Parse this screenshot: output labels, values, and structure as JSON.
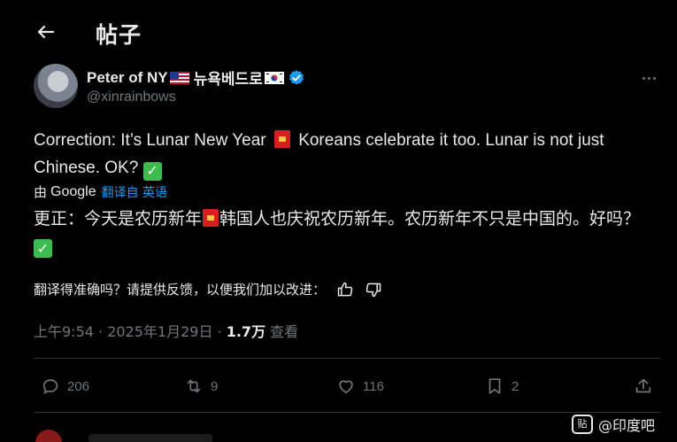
{
  "header": {
    "title": "帖子"
  },
  "author": {
    "name": "Peter of NY",
    "name_suffix": "뉴욕베드로",
    "handle": "@xinrainbows"
  },
  "tweet": {
    "text_part1": "Correction: It’s Lunar New Year",
    "text_part2": "Koreans celebrate it too. Lunar is not just Chinese. OK?"
  },
  "translation": {
    "by_label": "由",
    "provider": "Google",
    "link_label": "翻译自 英语",
    "text_part1": "更正：今天是农历新年",
    "text_part2": "韩国人也庆祝农历新年。农历新年不只是中国的。好吗？"
  },
  "feedback": {
    "prompt": "翻译得准确吗？请提供反馈，以便我们加以改进："
  },
  "meta": {
    "time_date": "上午9:54 · 2025年1月29日 · ",
    "views_count": "1.7万",
    "views_label": " 查看"
  },
  "actions": {
    "replies": "206",
    "reposts": "9",
    "likes": "116",
    "bookmarks": "2"
  },
  "watermark": {
    "text": "@印度吧",
    "icon_text": "贴"
  },
  "colors": {
    "background": "#000000",
    "link": "#1d9bf0",
    "muted": "#71767b",
    "verified": "#1d9bf0"
  }
}
